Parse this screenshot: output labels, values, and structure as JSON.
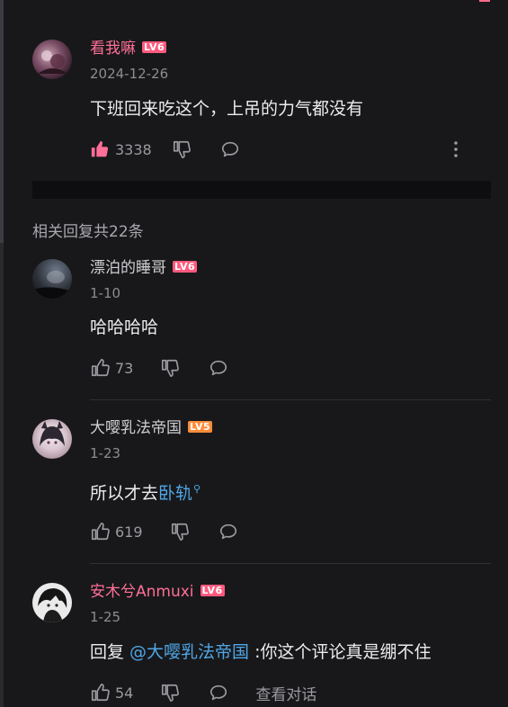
{
  "main_comment": {
    "username": "看我嘛",
    "level": "LV6",
    "date": "2024-12-26",
    "content": "下班回来吃这个，上吊的力气都没有",
    "like_count": "3338"
  },
  "replies_header": "相关回复共22条",
  "replies": [
    {
      "username": "漂泊的睡哥",
      "level": "LV6",
      "date": "1-10",
      "content": "哈哈哈哈",
      "like_count": "73"
    },
    {
      "username": "大嘤乳法帝国",
      "level": "LV5",
      "date": "1-23",
      "content_prefix": "所以才去",
      "content_link": "卧轨",
      "like_count": "619"
    },
    {
      "username": "安木兮Anmuxi",
      "level": "LV6",
      "date": "1-25",
      "reply_prefix": "回复 ",
      "reply_mention": "@大嘤乳法帝国",
      "content": " :你这个评论真是绷不住",
      "like_count": "54",
      "view_dialog": "查看对话"
    }
  ],
  "colors": {
    "background": "#18181a",
    "username_pink": "#ff6f98",
    "link_blue": "#4fa6e6",
    "like_active": "#ff6f98",
    "muted": "#9a9aa0"
  }
}
